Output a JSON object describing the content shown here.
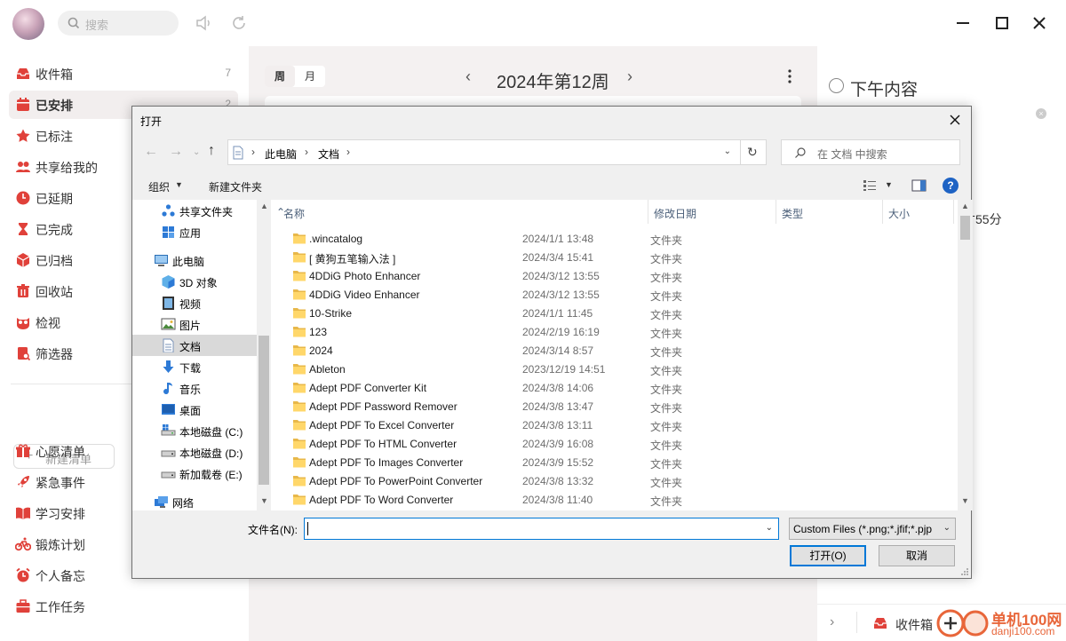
{
  "app": {
    "search_placeholder": "搜索",
    "sidebar": {
      "items": [
        {
          "label": "收件箱",
          "count": "7",
          "icon": "inbox-icon"
        },
        {
          "label": "已安排",
          "count": "2",
          "icon": "calendar-icon",
          "active": true
        },
        {
          "label": "已标注",
          "count": "",
          "icon": "star-icon"
        },
        {
          "label": "共享给我的",
          "count": "",
          "icon": "share-users-icon"
        },
        {
          "label": "已延期",
          "count": "",
          "icon": "clock-icon"
        },
        {
          "label": "已完成",
          "count": "",
          "icon": "hourglass-icon"
        },
        {
          "label": "已归档",
          "count": "",
          "icon": "box-icon"
        },
        {
          "label": "回收站",
          "count": "",
          "icon": "trash-icon"
        },
        {
          "label": "检视",
          "count": "",
          "icon": "owl-icon"
        },
        {
          "label": "筛选器",
          "count": "",
          "icon": "filter-doc-icon"
        }
      ],
      "new_list": "新建清单",
      "lists": [
        {
          "label": "心愿清单",
          "icon": "gift-icon"
        },
        {
          "label": "紧急事件",
          "icon": "rocket-icon"
        },
        {
          "label": "学习安排",
          "icon": "book-icon"
        },
        {
          "label": "锻炼计划",
          "icon": "bike-icon"
        },
        {
          "label": "个人备忘",
          "icon": "alarm-icon"
        },
        {
          "label": "工作任务",
          "icon": "briefcase-icon"
        }
      ]
    },
    "main": {
      "tab_week": "周",
      "tab_month": "月",
      "week_title": "2024年第12周"
    },
    "detail": {
      "title": "下午内容",
      "time_text": "寸55分",
      "bottom_label": "收件箱"
    },
    "watermark": {
      "line1": "单机100网",
      "line2": "danji100.com"
    },
    "accent": "#e0413a"
  },
  "dialog": {
    "title": "打开",
    "breadcrumb": [
      "此电脑",
      "文档"
    ],
    "search_placeholder": "在 文档 中搜索",
    "toolbar": {
      "organize": "组织",
      "new_folder": "新建文件夹"
    },
    "tree": [
      {
        "label": "共享文件夹",
        "icon": "shared-folder-icon",
        "indent": 1
      },
      {
        "label": "应用",
        "icon": "apps-icon",
        "indent": 1
      },
      {
        "label": "此电脑",
        "icon": "computer-icon",
        "indent": 0
      },
      {
        "label": "3D 对象",
        "icon": "cube-3d-icon",
        "indent": 1
      },
      {
        "label": "视频",
        "icon": "video-icon",
        "indent": 1
      },
      {
        "label": "图片",
        "icon": "picture-icon",
        "indent": 1
      },
      {
        "label": "文档",
        "icon": "document-icon",
        "indent": 1,
        "selected": true
      },
      {
        "label": "下载",
        "icon": "download-icon",
        "indent": 1
      },
      {
        "label": "音乐",
        "icon": "music-icon",
        "indent": 1
      },
      {
        "label": "桌面",
        "icon": "desktop-icon",
        "indent": 1
      },
      {
        "label": "本地磁盘 (C:)",
        "icon": "drive-c-icon",
        "indent": 1
      },
      {
        "label": "本地磁盘 (D:)",
        "icon": "drive-icon",
        "indent": 1
      },
      {
        "label": "新加载卷 (E:)",
        "icon": "drive-icon",
        "indent": 1
      },
      {
        "label": "网络",
        "icon": "network-icon",
        "indent": 0
      }
    ],
    "columns": {
      "name": "名称",
      "date": "修改日期",
      "type": "类型",
      "size": "大小"
    },
    "files": [
      {
        "name": ".wincatalog",
        "date": "2024/1/1 13:48",
        "type": "文件夹"
      },
      {
        "name": "[ 黄狗五笔输入法 ]",
        "date": "2024/3/4 15:41",
        "type": "文件夹"
      },
      {
        "name": "4DDiG Photo Enhancer",
        "date": "2024/3/12 13:55",
        "type": "文件夹"
      },
      {
        "name": "4DDiG Video Enhancer",
        "date": "2024/3/12 13:55",
        "type": "文件夹"
      },
      {
        "name": "10-Strike",
        "date": "2024/1/1 11:45",
        "type": "文件夹"
      },
      {
        "name": "123",
        "date": "2024/2/19 16:19",
        "type": "文件夹"
      },
      {
        "name": "2024",
        "date": "2024/3/14 8:57",
        "type": "文件夹"
      },
      {
        "name": "Ableton",
        "date": "2023/12/19 14:51",
        "type": "文件夹"
      },
      {
        "name": "Adept PDF Converter Kit",
        "date": "2024/3/8 14:06",
        "type": "文件夹"
      },
      {
        "name": "Adept PDF Password Remover",
        "date": "2024/3/8 13:47",
        "type": "文件夹"
      },
      {
        "name": "Adept PDF To Excel Converter",
        "date": "2024/3/8 13:11",
        "type": "文件夹"
      },
      {
        "name": "Adept PDF To HTML Converter",
        "date": "2024/3/9 16:08",
        "type": "文件夹"
      },
      {
        "name": "Adept PDF To Images Converter",
        "date": "2024/3/9 15:52",
        "type": "文件夹"
      },
      {
        "name": "Adept PDF To PowerPoint Converter",
        "date": "2024/3/8 13:32",
        "type": "文件夹"
      },
      {
        "name": "Adept PDF To Word Converter",
        "date": "2024/3/8 11:40",
        "type": "文件夹"
      }
    ],
    "filename_label": "文件名(N):",
    "filename_value": "",
    "filetype_value": "Custom Files (*.png;*.jfif;*.pjp",
    "open_label": "打开(O)",
    "cancel_label": "取消"
  }
}
